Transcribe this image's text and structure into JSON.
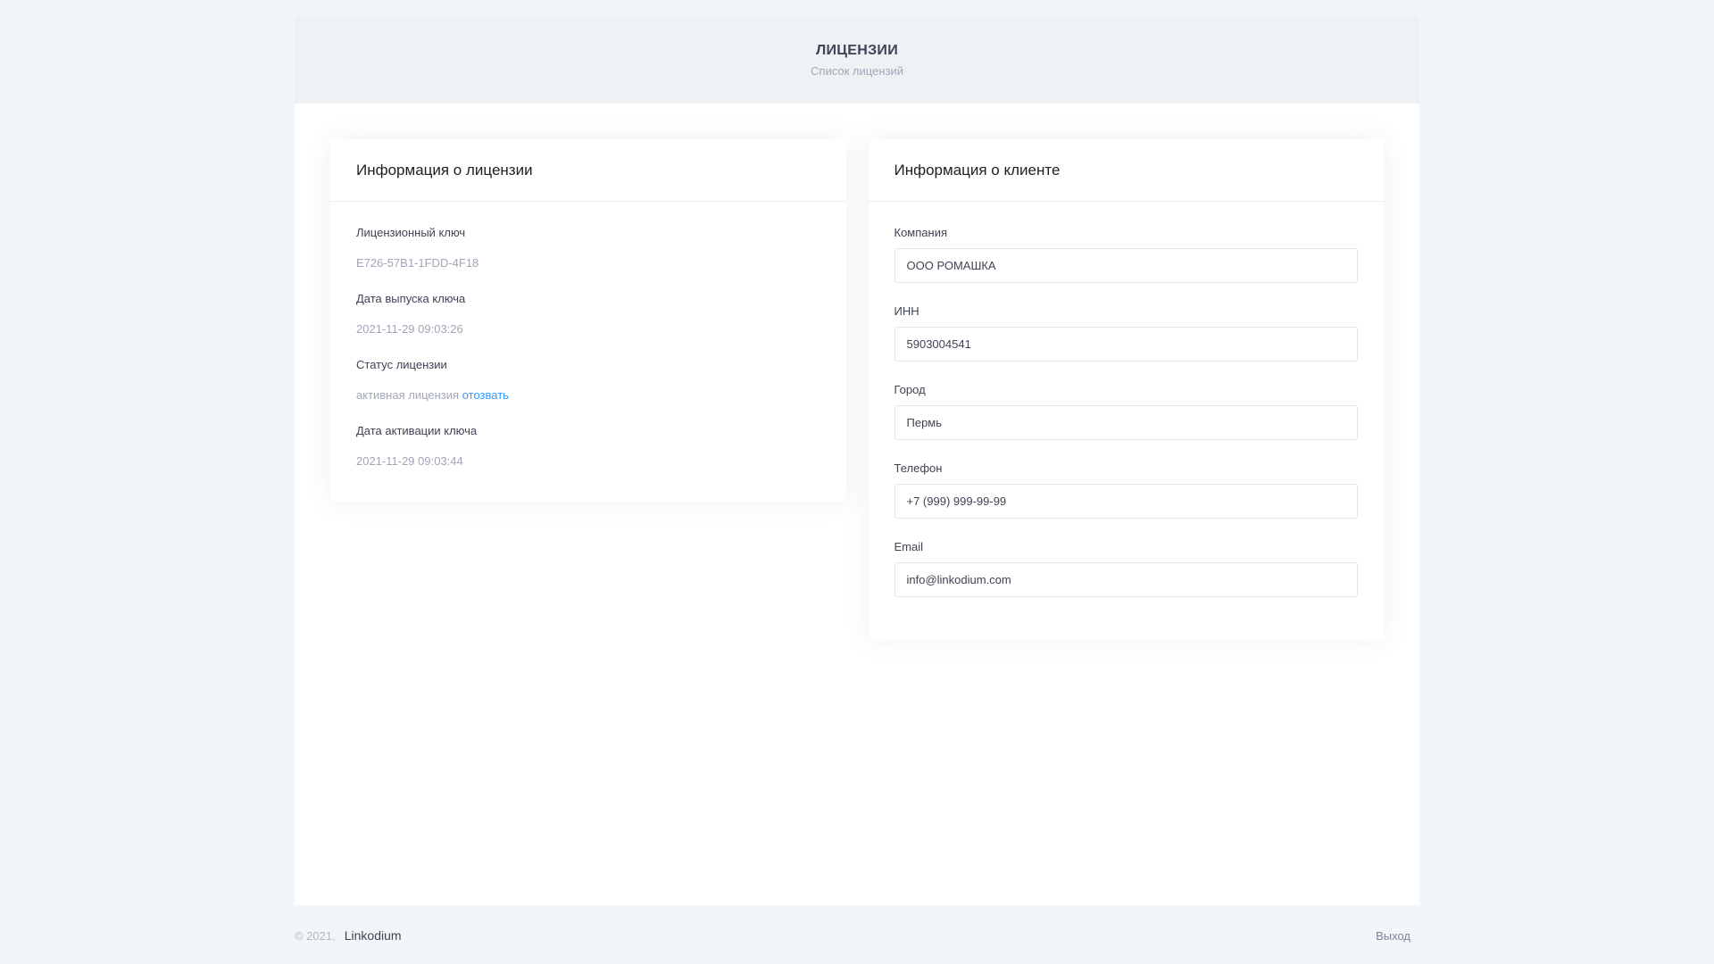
{
  "header": {
    "title": "ЛИЦЕНЗИИ",
    "subtitle": "Список лицензий"
  },
  "license_card": {
    "title": "Информация о лицензии",
    "fields": [
      {
        "label": "Лицензионный ключ",
        "value": "E726-57B1-1FDD-4F18"
      },
      {
        "label": "Дата выпуска ключа",
        "value": "2021-11-29 09:03:26"
      },
      {
        "label": "Статус лицензии",
        "value": "активная лицензия",
        "action": "отозвать"
      },
      {
        "label": "Дата активации ключа",
        "value": "2021-11-29 09:03:44"
      }
    ]
  },
  "client_card": {
    "title": "Информация о клиенте",
    "fields": [
      {
        "label": "Компания",
        "value": "ООО РОМАШКА"
      },
      {
        "label": "ИНН",
        "value": "5903004541"
      },
      {
        "label": "Город",
        "value": "Пермь"
      },
      {
        "label": "Телефон",
        "value": "+7 (999) 999-99-99"
      },
      {
        "label": "Email",
        "value": "info@linkodium.com"
      }
    ]
  },
  "footer": {
    "copyright": "© 2021,",
    "brand": "Linkodium",
    "logout": "Выход"
  },
  "colors": {
    "accent": "#3699ff",
    "page_bg": "#f3f6f9",
    "subheader_bg": "#eff2f5",
    "muted_text": "#a1a5b7"
  }
}
